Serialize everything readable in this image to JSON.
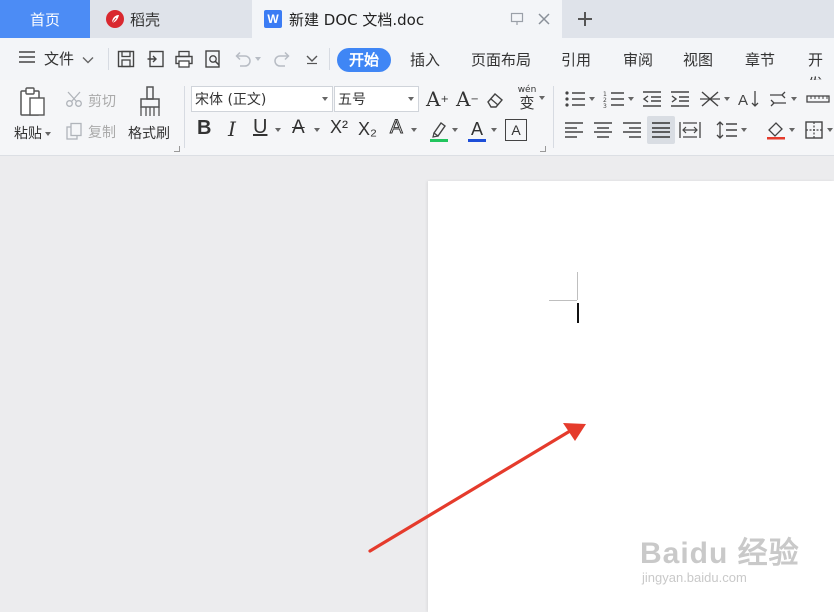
{
  "tabs": {
    "home": "首页",
    "daoke": "稻壳",
    "document": "新建 DOC 文档.doc"
  },
  "menu": {
    "file": "文件",
    "ribbon_tabs": [
      "开始",
      "插入",
      "页面布局",
      "引用",
      "审阅",
      "视图",
      "章节",
      "开发"
    ],
    "active_tab": "开始"
  },
  "ribbon": {
    "paste": "粘贴",
    "cut": "剪切",
    "copy": "复制",
    "format_painter": "格式刷",
    "font_name": "宋体 (正文)",
    "font_size": "五号",
    "bold": "B",
    "italic": "I",
    "underline": "U",
    "strikethrough": "A",
    "superscript": "X²",
    "subscript": "X₂",
    "text_effect": "A",
    "highlight": "A",
    "font_color": "A",
    "char_border": "A",
    "grow_font": "A",
    "shrink_font": "A",
    "pinyin": "wén",
    "pinyin_char": "变"
  },
  "watermark": {
    "brand": "Baidu 经验",
    "url": "jingyan.baidu.com"
  },
  "colors": {
    "accent": "#3f86f5",
    "home_tab": "#4c8cf5",
    "arrow": "#e53b2c",
    "highlight_bar": "#22c55e",
    "font_color_bar": "#1d4ed8"
  }
}
